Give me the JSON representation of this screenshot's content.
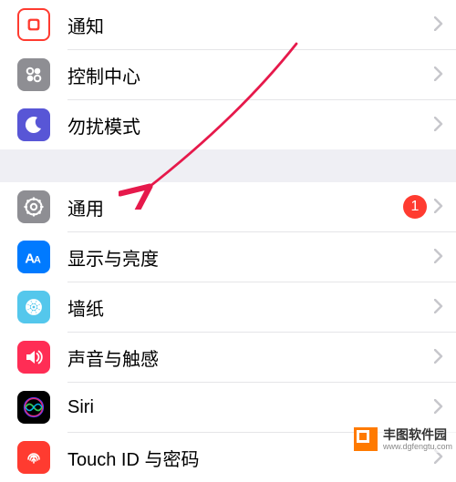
{
  "group1": {
    "items": [
      {
        "label": "通知"
      },
      {
        "label": "控制中心"
      },
      {
        "label": "勿扰模式"
      }
    ]
  },
  "group2": {
    "items": [
      {
        "label": "通用",
        "badge": "1"
      },
      {
        "label": "显示与亮度"
      },
      {
        "label": "墙纸"
      },
      {
        "label": "声音与触感"
      },
      {
        "label": "Siri"
      },
      {
        "label": "Touch ID 与密码"
      }
    ]
  },
  "watermark": {
    "name": "丰图软件园",
    "url": "www.dgfengtu.com"
  },
  "colors": {
    "badge": "#ff3b30",
    "arrow": "#e6194b"
  }
}
